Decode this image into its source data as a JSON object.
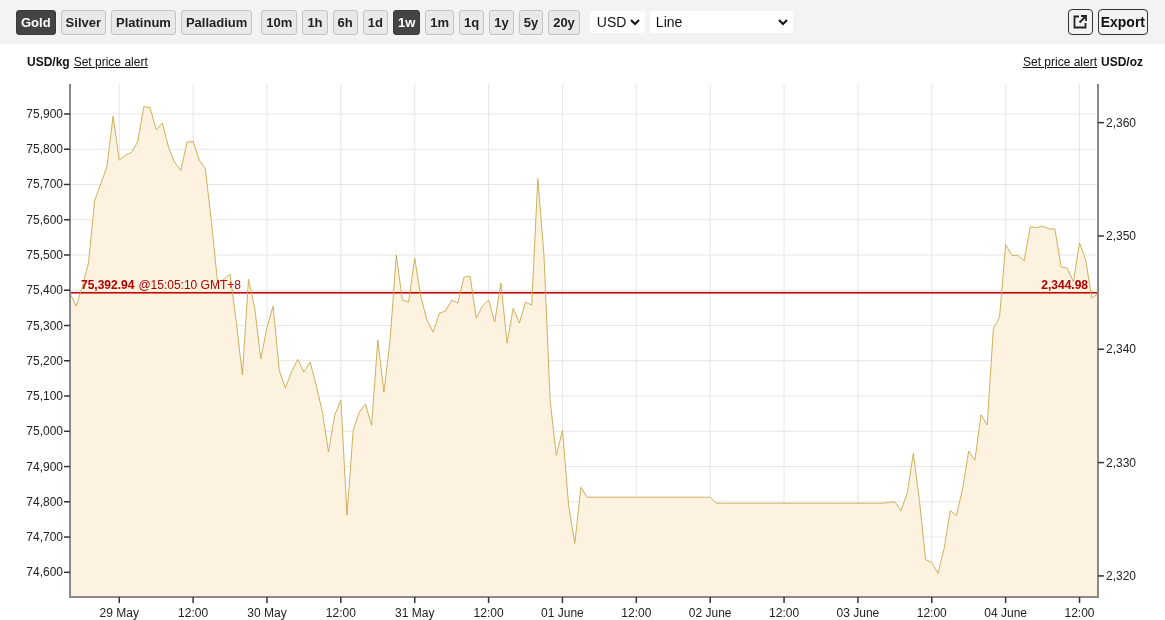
{
  "toolbar": {
    "metals": [
      {
        "label": "Gold",
        "selected": true
      },
      {
        "label": "Silver",
        "selected": false
      },
      {
        "label": "Platinum",
        "selected": false
      },
      {
        "label": "Palladium",
        "selected": false
      }
    ],
    "ranges": [
      {
        "label": "10m",
        "selected": false
      },
      {
        "label": "1h",
        "selected": false
      },
      {
        "label": "6h",
        "selected": false
      },
      {
        "label": "1d",
        "selected": false
      },
      {
        "label": "1w",
        "selected": true
      },
      {
        "label": "1m",
        "selected": false
      },
      {
        "label": "1q",
        "selected": false
      },
      {
        "label": "1y",
        "selected": false
      },
      {
        "label": "5y",
        "selected": false
      },
      {
        "label": "20y",
        "selected": false
      }
    ],
    "currency_select": {
      "value": "USD"
    },
    "chart_type_select": {
      "value": "Line"
    },
    "export_button": {
      "label": "Export"
    }
  },
  "chart": {
    "price_alert_links": [
      {
        "label": "Set price alert"
      },
      {
        "label": "Set price alert"
      }
    ],
    "price_line_time": "@15:05:10 GMT+8",
    "price_line_right_label": "2,344.98",
    "chart_data": {
      "type": "area",
      "ylabel": "USD/kg",
      "y2label": "USD/oz",
      "grid": true,
      "categories": [
        null,
        null,
        null,
        null,
        null,
        null,
        null,
        null,
        "29 May",
        null,
        null,
        null,
        null,
        null,
        null,
        null,
        null,
        null,
        null,
        null,
        "12:00",
        null,
        null,
        null,
        null,
        null,
        null,
        null,
        null,
        null,
        null,
        null,
        "30 May",
        null,
        null,
        null,
        null,
        null,
        null,
        null,
        null,
        null,
        null,
        null,
        "12:00",
        null,
        null,
        null,
        null,
        null,
        null,
        null,
        null,
        null,
        null,
        null,
        "31 May",
        null,
        null,
        null,
        null,
        null,
        null,
        null,
        null,
        null,
        null,
        null,
        "12:00",
        null,
        null,
        null,
        null,
        null,
        null,
        null,
        null,
        null,
        null,
        null,
        "01 June",
        null,
        null,
        null,
        null,
        null,
        null,
        null,
        null,
        null,
        null,
        null,
        "12:00",
        null,
        null,
        null,
        null,
        null,
        null,
        null,
        null,
        null,
        null,
        null,
        "02 June",
        null,
        null,
        null,
        null,
        null,
        null,
        null,
        null,
        null,
        null,
        null,
        "12:00",
        null,
        null,
        null,
        null,
        null,
        null,
        null,
        null,
        null,
        null,
        null,
        "03 June",
        null,
        null,
        null,
        null,
        null,
        null,
        null,
        null,
        null,
        null,
        null,
        "12:00",
        null,
        null,
        null,
        null,
        null,
        null,
        null,
        null,
        null,
        null,
        null,
        "04 June",
        null,
        null,
        null,
        null,
        null,
        null,
        null,
        null,
        null,
        null,
        null,
        "12:00",
        null,
        null,
        null
      ],
      "values": [
        75392,
        75355,
        75410,
        75478,
        75654,
        75702,
        75750,
        75894,
        75769,
        75783,
        75791,
        75822,
        75921,
        75918,
        75855,
        75874,
        75806,
        75763,
        75740,
        75820,
        75822,
        75769,
        75744,
        75590,
        75419,
        75431,
        75446,
        75311,
        75160,
        75431,
        75350,
        75206,
        75294,
        75355,
        75172,
        75123,
        75169,
        75204,
        75168,
        75196,
        75131,
        75054,
        74941,
        75046,
        75088,
        74762,
        75003,
        75054,
        75077,
        75017,
        75259,
        75111,
        75259,
        75500,
        75372,
        75366,
        75491,
        75381,
        75315,
        75281,
        75335,
        75341,
        75372,
        75364,
        75437,
        75440,
        75321,
        75355,
        75372,
        75310,
        75420,
        75250,
        75349,
        75307,
        75366,
        75358,
        75716,
        75497,
        75088,
        74932,
        75003,
        74790,
        74682,
        74841,
        74813,
        74813,
        74813,
        74813,
        74813,
        74813,
        74813,
        74813,
        74813,
        74813,
        74813,
        74813,
        74813,
        74813,
        74813,
        74813,
        74813,
        74813,
        74813,
        74813,
        74813,
        74796,
        74796,
        74796,
        74796,
        74796,
        74796,
        74796,
        74796,
        74796,
        74796,
        74796,
        74796,
        74796,
        74796,
        74796,
        74796,
        74796,
        74796,
        74796,
        74796,
        74796,
        74796,
        74796,
        74796,
        74796,
        74796,
        74796,
        74796,
        74798,
        74800,
        74775,
        74824,
        74937,
        74802,
        74636,
        74628,
        74597,
        74667,
        74775,
        74761,
        74837,
        74944,
        74918,
        75047,
        75018,
        75292,
        75323,
        75529,
        75499,
        75499,
        75483,
        75580,
        75578,
        75582,
        75574,
        75574,
        75466,
        75463,
        75424,
        75534,
        75486,
        75378,
        75390
      ],
      "ylim": [
        74530,
        75985
      ],
      "yticks": [
        {
          "value": 75900,
          "label": "75,900"
        },
        {
          "value": 75800,
          "label": "75,800"
        },
        {
          "value": 75700,
          "label": "75,700"
        },
        {
          "value": 75600,
          "label": "75,600"
        },
        {
          "value": 75500,
          "label": "75,500"
        },
        {
          "value": 75400,
          "label": "75,400"
        },
        {
          "value": 75300,
          "label": "75,300"
        },
        {
          "value": 75200,
          "label": "75,200"
        },
        {
          "value": 75100,
          "label": "75,100"
        },
        {
          "value": 75000,
          "label": "75,000"
        },
        {
          "value": 74900,
          "label": "74,900"
        },
        {
          "value": 74800,
          "label": "74,800"
        },
        {
          "value": 74700,
          "label": "74,700"
        },
        {
          "value": 74600,
          "label": "74,600"
        }
      ],
      "y2lim": [
        2318.14,
        2363.41
      ],
      "y2ticks": [
        {
          "value": 2360,
          "label": "2,360"
        },
        {
          "value": 2350,
          "label": "2,350"
        },
        {
          "value": 2340,
          "label": "2,340"
        },
        {
          "value": 2330,
          "label": "2,330"
        },
        {
          "value": 2320,
          "label": "2,320"
        }
      ],
      "ref_lines": [
        {
          "axis": "y",
          "value": 75392.94,
          "label": "75,392.94"
        }
      ]
    }
  }
}
